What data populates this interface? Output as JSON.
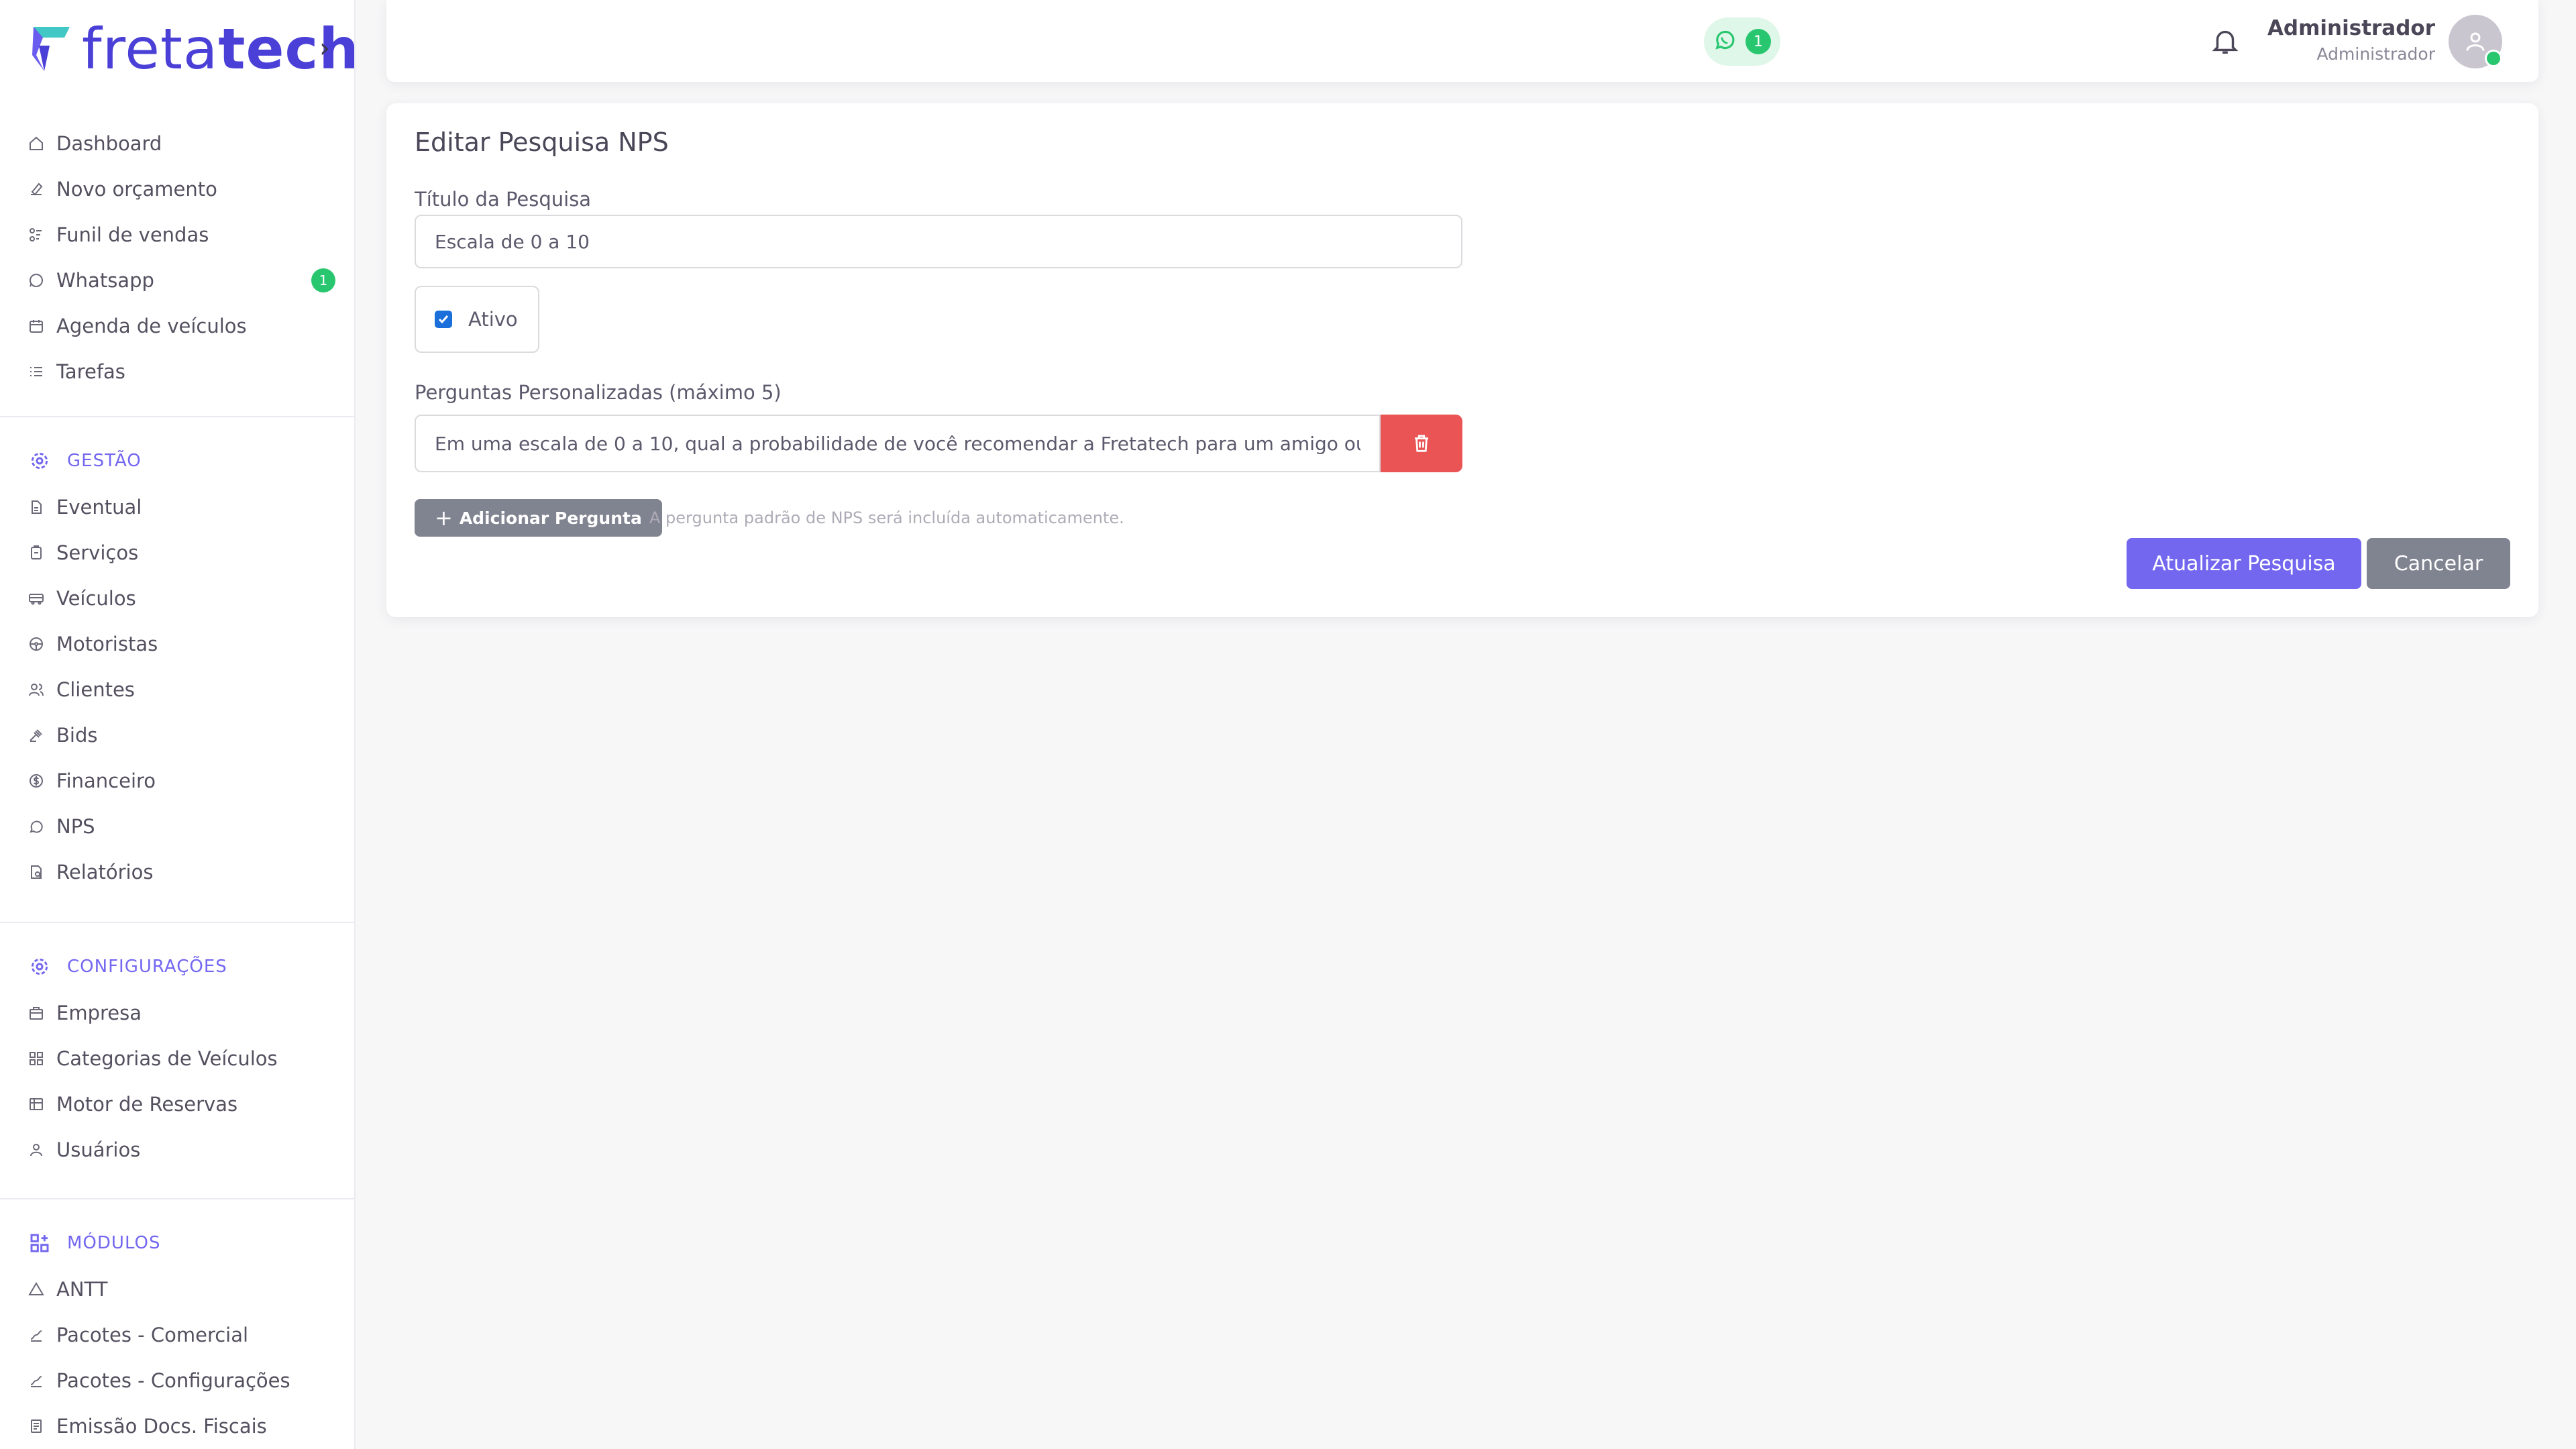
{
  "brand": {
    "logo_light": "freta",
    "logo_bold": "tech",
    "accent_color": "#7367f0",
    "logo_color": "#4a3fd6"
  },
  "sidebar": {
    "main_items": [
      {
        "label": "Dashboard",
        "icon": "home-icon"
      },
      {
        "label": "Novo orçamento",
        "icon": "edit-icon"
      },
      {
        "label": "Funil de vendas",
        "icon": "funnel-icon"
      },
      {
        "label": "Whatsapp",
        "icon": "whatsapp-icon",
        "badge": "1"
      },
      {
        "label": "Agenda de veículos",
        "icon": "calendar-icon"
      },
      {
        "label": "Tarefas",
        "icon": "list-icon"
      }
    ],
    "sections": [
      {
        "title": "GESTÃO",
        "icon": "gear-icon",
        "items": [
          {
            "label": "Eventual",
            "icon": "file-icon"
          },
          {
            "label": "Serviços",
            "icon": "clipboard-icon"
          },
          {
            "label": "Veículos",
            "icon": "bus-icon"
          },
          {
            "label": "Motoristas",
            "icon": "steering-wheel-icon"
          },
          {
            "label": "Clientes",
            "icon": "users-icon"
          },
          {
            "label": "Bids",
            "icon": "gavel-icon"
          },
          {
            "label": "Financeiro",
            "icon": "coin-icon"
          },
          {
            "label": "NPS",
            "icon": "chat-icon"
          },
          {
            "label": "Relatórios",
            "icon": "report-icon"
          }
        ]
      },
      {
        "title": "CONFIGURAÇÕES",
        "icon": "gear-icon",
        "items": [
          {
            "label": "Empresa",
            "icon": "building-icon"
          },
          {
            "label": "Categorias de Veículos",
            "icon": "grid-icon"
          },
          {
            "label": "Motor de Reservas",
            "icon": "table-icon"
          },
          {
            "label": "Usuários",
            "icon": "user-icon"
          }
        ]
      },
      {
        "title": "MÓDULOS",
        "icon": "modules-icon",
        "items": [
          {
            "label": "ANTT",
            "icon": "triangle-icon"
          },
          {
            "label": "Pacotes - Comercial",
            "icon": "package-icon"
          },
          {
            "label": "Pacotes - Configurações",
            "icon": "package-icon"
          },
          {
            "label": "Emissão Docs. Fiscais",
            "icon": "document-icon"
          }
        ]
      }
    ]
  },
  "topbar": {
    "whatsapp_count": "1",
    "user_name": "Administrador",
    "user_role": "Administrador"
  },
  "form": {
    "title": "Editar Pesquisa NPS",
    "survey_title_label": "Título da Pesquisa",
    "survey_title_value": "Escala de 0 a 10",
    "active_label": "Ativo",
    "active_checked": true,
    "questions_label": "Perguntas Personalizadas (máximo 5)",
    "questions": [
      "Em uma escala de 0 a 10, qual a probabilidade de você recomendar a Fretatech para um amigo ou"
    ],
    "add_question_label": "Adicionar Pergunta",
    "hint": "A pergunta padrão de NPS será incluída automaticamente.",
    "submit_label": "Atualizar Pesquisa",
    "cancel_label": "Cancelar"
  }
}
